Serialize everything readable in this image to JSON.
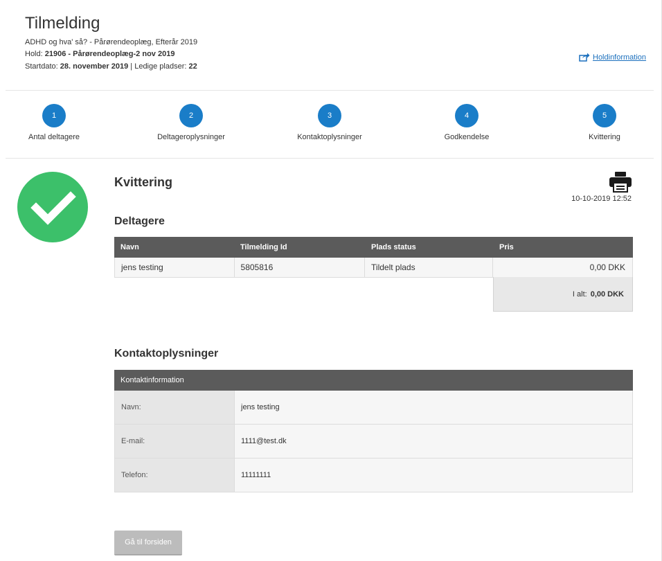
{
  "header": {
    "title": "Tilmelding",
    "course_line": "ADHD og hva' så? - Pårørendeoplæg, Efterår 2019",
    "hold_label": "Hold:",
    "hold_value": "21906 - Pårørendeoplæg-2 nov 2019",
    "startdate_label": "Startdato:",
    "startdate_value": "28. november 2019",
    "separator": " | ",
    "seats_label": "Ledige pladser:",
    "seats_value": "22",
    "holdinfo_link": "Holdinformation"
  },
  "steps": [
    {
      "number": "1",
      "label": "Antal deltagere"
    },
    {
      "number": "2",
      "label": "Deltageroplysninger"
    },
    {
      "number": "3",
      "label": "Kontaktoplysninger"
    },
    {
      "number": "4",
      "label": "Godkendelse"
    },
    {
      "number": "5",
      "label": "Kvittering"
    }
  ],
  "receipt": {
    "title": "Kvittering",
    "datetime": "10-10-2019 12:52"
  },
  "participants": {
    "title": "Deltagere",
    "columns": [
      "Navn",
      "Tilmelding Id",
      "Plads status",
      "Pris"
    ],
    "rows": [
      {
        "name": "jens testing",
        "id": "5805816",
        "status": "Tildelt plads",
        "price": "0,00 DKK"
      }
    ],
    "total_label": "I alt:",
    "total_value": "0,00 DKK"
  },
  "contact": {
    "title": "Kontaktoplysninger",
    "header": "Kontaktinformation",
    "rows": [
      {
        "key": "Navn:",
        "value": "jens testing"
      },
      {
        "key": "E-mail:",
        "value": "1111@test.dk"
      },
      {
        "key": "Telefon:",
        "value": "11111111"
      }
    ]
  },
  "actions": {
    "home_button": "Gå til forsiden"
  },
  "colors": {
    "step_blue": "#1a7dc8",
    "success_green": "#3cc06a",
    "table_header": "#5b5b5b",
    "link": "#1a6fbd"
  }
}
